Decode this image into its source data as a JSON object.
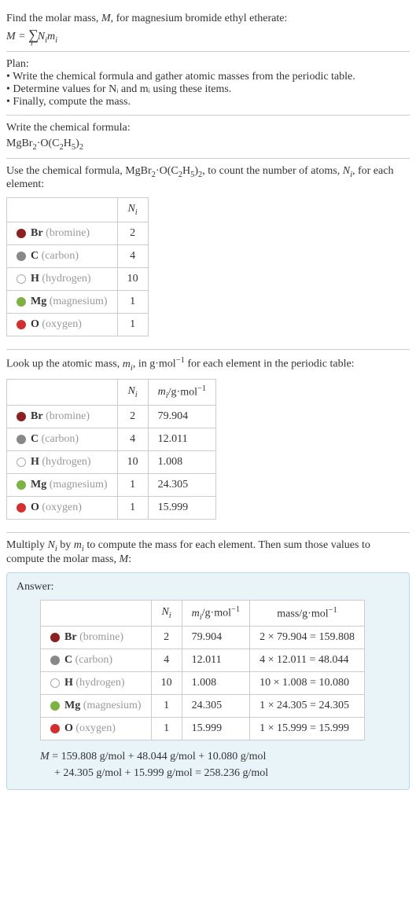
{
  "intro": {
    "line1_prefix": "Find the molar mass, ",
    "line1_var": "M",
    "line1_suffix": ", for magnesium bromide ethyl etherate:",
    "eq_prefix": "M = ",
    "eq_sum_under": "i",
    "eq_rest": " Nᵢmᵢ"
  },
  "plan": {
    "title": "Plan:",
    "bullets": [
      "• Write the chemical formula and gather atomic masses from the periodic table.",
      "• Determine values for Nᵢ and mᵢ using these items.",
      "• Finally, compute the mass."
    ]
  },
  "write_formula": {
    "title": "Write the chemical formula:",
    "formula": "MgBr₂·O(C₂H₅)₂"
  },
  "count_atoms": {
    "text_prefix": "Use the chemical formula, MgBr",
    "text_mid": "·O(C",
    "text_h": "H",
    "text_close": ")",
    "text_suffix": ", to count the number of atoms, ",
    "text_ni": "Nᵢ",
    "text_end": ", for each element:"
  },
  "headers": {
    "ni": "Nᵢ",
    "mi": "mᵢ/g·mol⁻¹",
    "mass": "mass/g·mol⁻¹"
  },
  "elements": [
    {
      "sym": "Br",
      "name": "(bromine)",
      "dot": "dot-br",
      "ni": "2",
      "mi": "79.904",
      "mass": "2 × 79.904 = 159.808"
    },
    {
      "sym": "C",
      "name": "(carbon)",
      "dot": "dot-c",
      "ni": "4",
      "mi": "12.011",
      "mass": "4 × 12.011 = 48.044"
    },
    {
      "sym": "H",
      "name": "(hydrogen)",
      "dot": "dot-h",
      "ni": "10",
      "mi": "1.008",
      "mass": "10 × 1.008 = 10.080"
    },
    {
      "sym": "Mg",
      "name": "(magnesium)",
      "dot": "dot-mg",
      "ni": "1",
      "mi": "24.305",
      "mass": "1 × 24.305 = 24.305"
    },
    {
      "sym": "O",
      "name": "(oxygen)",
      "dot": "dot-o",
      "ni": "1",
      "mi": "15.999",
      "mass": "1 × 15.999 = 15.999"
    }
  ],
  "lookup": {
    "text_prefix": "Look up the atomic mass, ",
    "text_mi": "mᵢ",
    "text_mid": ", in g·mol",
    "text_supneg1": "−1",
    "text_suffix": " for each element in the periodic table:"
  },
  "multiply": {
    "text": "Multiply Nᵢ by mᵢ to compute the mass for each element. Then sum those values to compute the molar mass, M:"
  },
  "answer": {
    "title": "Answer:",
    "final_line1": "M = 159.808 g/mol + 48.044 g/mol + 10.080 g/mol",
    "final_line2": "+ 24.305 g/mol + 15.999 g/mol = 258.236 g/mol"
  }
}
